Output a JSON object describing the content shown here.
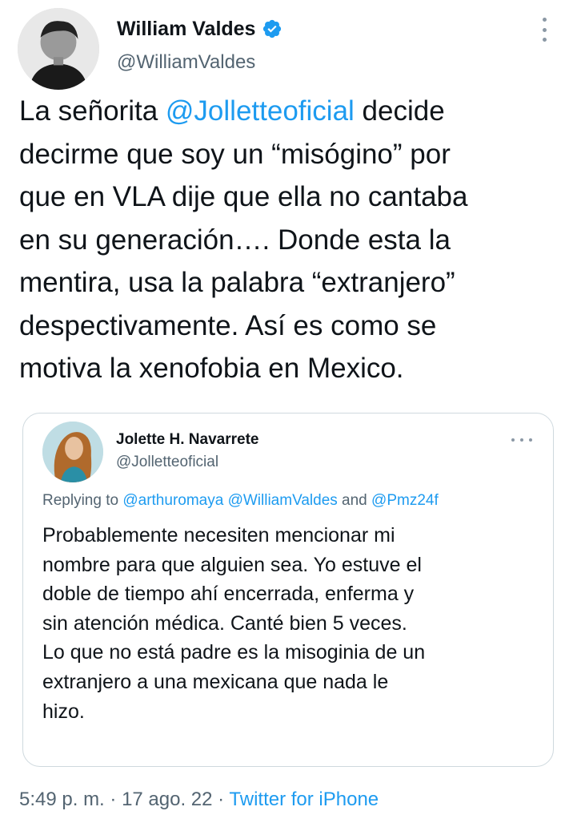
{
  "tweet": {
    "author_name": "William Valdes",
    "author_handle": "@WilliamValdes",
    "verified_icon": "verified-badge-icon",
    "more_icon": "more-vertical-icon",
    "text_lines": {
      "l1_a": "La señorita ",
      "l1_mention": "@Jolletteoficial",
      "l1_b": " decide",
      "l2": "decirme que soy un “misógino” por",
      "l3": "que en VLA dije que ella no cantaba",
      "l4": "en su generación…. Donde esta la",
      "l5": "mentira, usa la palabra “extranjero”",
      "l6": "despectivamente. Así es como se",
      "l7": "motiva la xenofobia en Mexico."
    }
  },
  "quote": {
    "author_name": "Jolette H. Navarrete",
    "author_handle": "@Jolletteoficial",
    "more_icon": "more-horizontal-icon",
    "replying_prefix": "Replying to ",
    "replying_mention_1": "@arthuromaya",
    "replying_mention_2": "@WilliamValdes",
    "replying_and": " and ",
    "replying_mention_3": "@Pmz24f",
    "text_lines": {
      "l1": "Probablemente necesiten mencionar mi",
      "l2": "nombre para que alguien sea. Yo estuve el",
      "l3": "doble de tiempo ahí encerrada, enferma y",
      "l4": "sin atención médica. Canté bien 5 veces.",
      "l5": "Lo que no está padre es la misoginia de un",
      "l6": "extranjero a una mexicana que nada le",
      "l7": "hizo."
    }
  },
  "footer": {
    "time": "5:49 p. m.",
    "separator": " · ",
    "date": "17 ago. 22",
    "source": "Twitter for iPhone"
  },
  "colors": {
    "link": "#1d9bf0",
    "secondary_text": "#536471",
    "primary_text": "#0f1419",
    "border": "#cfd9de"
  }
}
